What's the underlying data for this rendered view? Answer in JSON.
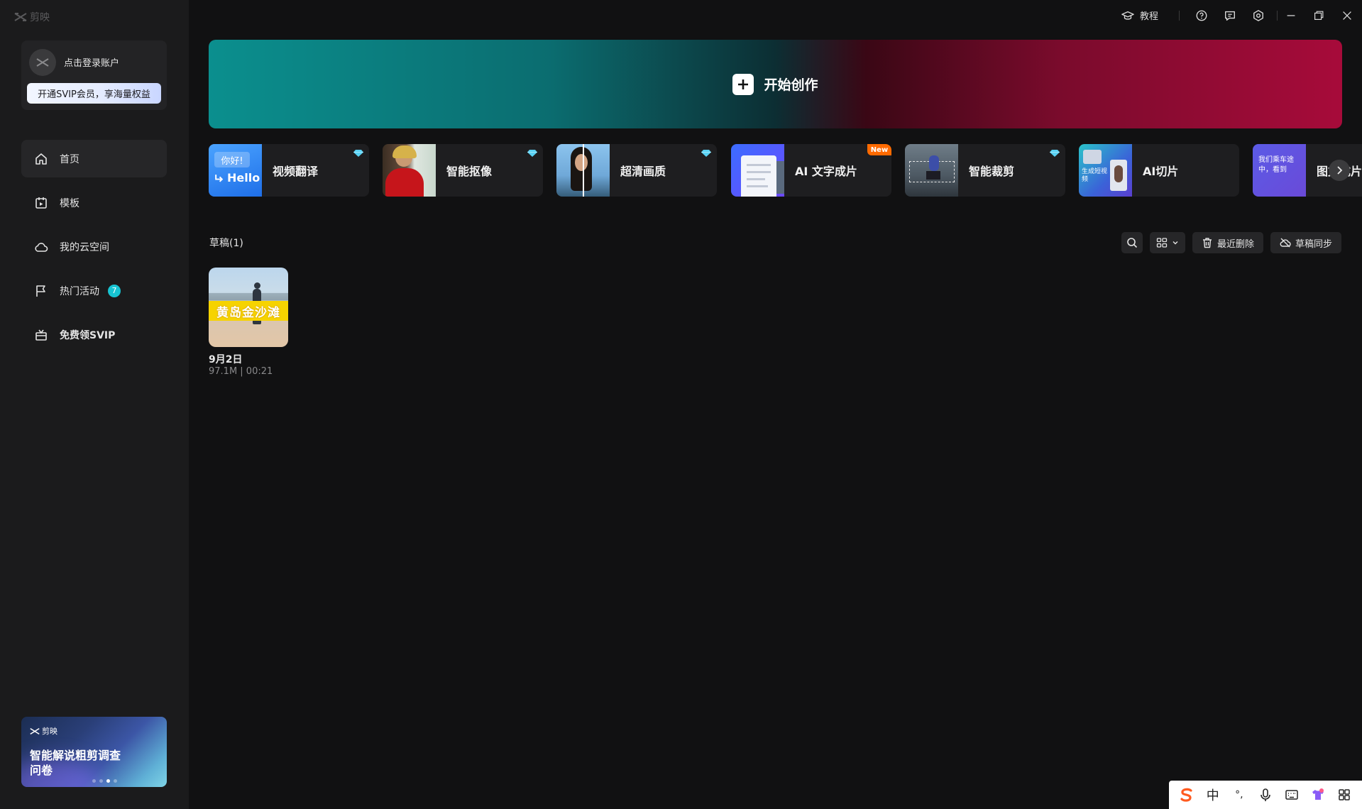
{
  "app": {
    "logo_text": "剪映"
  },
  "account": {
    "login_text": "点击登录账户",
    "svip_label": "开通SVIP会员，享海量权益"
  },
  "nav": [
    {
      "id": "home",
      "label": "首页",
      "icon": "home-icon"
    },
    {
      "id": "templates",
      "label": "模板",
      "icon": "template-icon"
    },
    {
      "id": "cloud",
      "label": "我的云空间",
      "icon": "cloud-icon"
    },
    {
      "id": "events",
      "label": "热门活动",
      "icon": "flag-icon",
      "badge": "7"
    },
    {
      "id": "svip",
      "label": "免费领SVIP",
      "icon": "gift-icon"
    }
  ],
  "survey": {
    "logo_text": "剪映",
    "text": "智能解说粗剪调查问卷"
  },
  "titlebar": {
    "tutorial_label": "教程"
  },
  "create": {
    "label": "开始创作"
  },
  "tools": [
    {
      "label": "视频翻译",
      "tag": "gem",
      "thumb_text_1": "你好!",
      "thumb_text_2": "Hello"
    },
    {
      "label": "智能抠像",
      "tag": "gem"
    },
    {
      "label": "超清画质",
      "tag": "gem"
    },
    {
      "label": "AI 文字成片",
      "tag": "New"
    },
    {
      "label": "智能裁剪",
      "tag": "gem"
    },
    {
      "label": "AI切片",
      "thumb_text_1": "生成短视频"
    },
    {
      "label": "图文成片",
      "thumb_text_1": "我们乘车途中，看到"
    }
  ],
  "drafts": {
    "title": "草稿(1)",
    "recent_delete_label": "最近删除",
    "sync_label": "草稿同步",
    "items": [
      {
        "caption": "黄岛金沙滩",
        "name": "9月2日",
        "meta": "97.1M | 00:21"
      }
    ]
  },
  "ime": {
    "lang": "中",
    "punct": "°,"
  },
  "colors": {
    "accent": "#17c4d2",
    "banner_left": "#0b8f8e",
    "banner_right": "#a70b3a",
    "new_tag": "#ff6a00"
  }
}
